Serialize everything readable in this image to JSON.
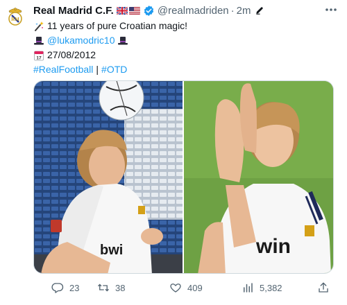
{
  "colors": {
    "link": "#1d9bf0",
    "secondary": "#536471",
    "text": "#0f1419",
    "verified": "#1d9bf0"
  },
  "author": {
    "name": "Real Madrid C.F.",
    "handle": "@realmadriden",
    "separator": "·",
    "time": "2m",
    "avatar_icon": "real-madrid-crest",
    "flags": [
      "uk-flag",
      "us-flag"
    ]
  },
  "tweet": {
    "line1_text": "11 years of pure Croatian magic!",
    "line1_emoji": "magic-wand-sparkles",
    "mention": "@lukamodric10",
    "mention_emoji": "top-hat",
    "date": "27/08/2012",
    "date_emoji": "calendar",
    "hashtag1": "#RealFootball",
    "divider": "|",
    "hashtag2": "#OTD"
  },
  "media": {
    "left_photo": "player-juggling-ball-in-stadium",
    "right_photo": "player-clapping-on-pitch"
  },
  "actions": {
    "replies": "23",
    "retweets": "38",
    "likes": "409",
    "views": "5,382"
  }
}
